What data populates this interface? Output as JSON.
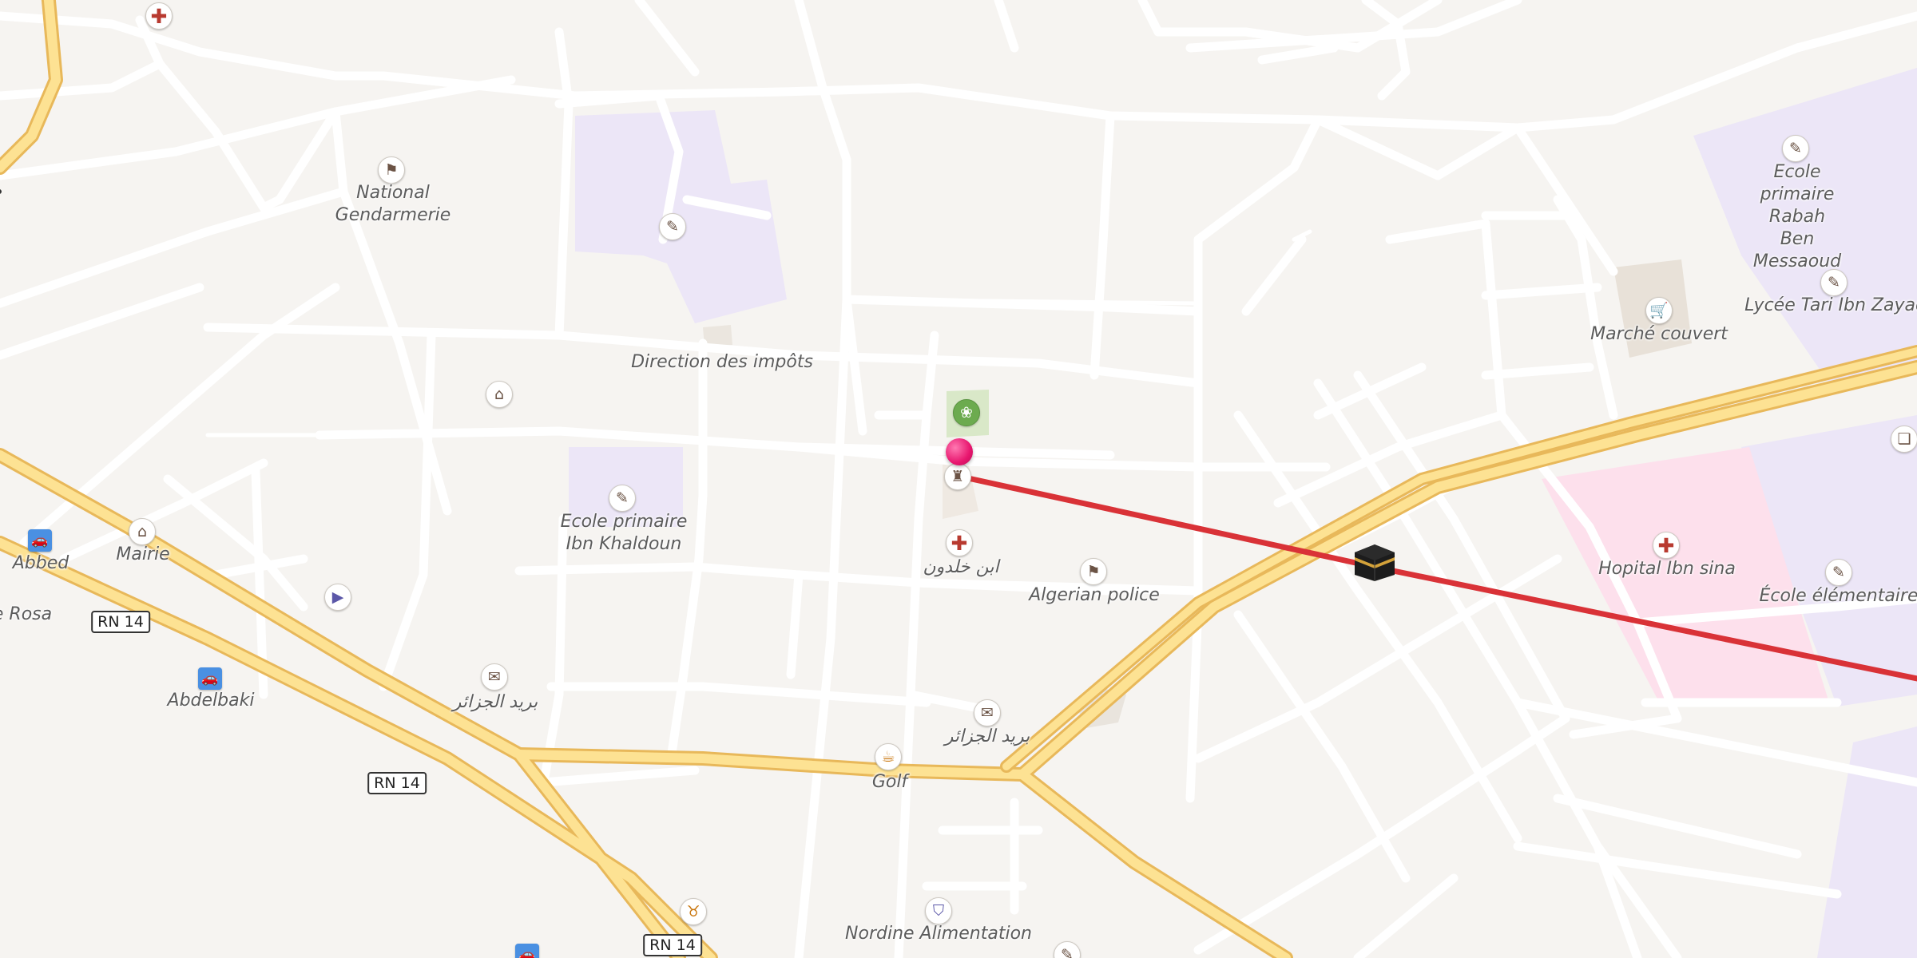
{
  "map": {
    "labels": {
      "national_gendarmerie": "National\nGendarmerie",
      "direction_impots": "Direction des impôts",
      "ecole_ibn_khaldoun": "Ecole primaire\nIbn Khaldoun",
      "ibn_khaldoun_ar": "ابن خلدون",
      "algerian_police": "Algerian police",
      "mairie": "Mairie",
      "abbed": "Abbed",
      "rosa": "e Rosa",
      "abdelbaki": "Abdelbaki",
      "barid_1": "بريد الجزائر",
      "barid_2": "بريد الجزائر",
      "golf": "Golf",
      "nordine": "Nordine Alimentation",
      "ecole_rabah": "Ecole primaire Rabah\nBen Messaoud",
      "lycee_tari": "Lycée Tari Ibn Zayad",
      "marche_couvert": "Marché couvert",
      "hopital": "Hopital Ibn sina",
      "ecole_elementaire": "École élémentaire"
    },
    "road_shields": [
      "RN 14",
      "RN 14",
      "RN 14"
    ],
    "icons": {
      "hospital": "hospital-icon",
      "police": "police-icon",
      "school": "school-icon",
      "townhall": "townhall-icon",
      "post": "post-office-icon",
      "cafe": "cafe-icon",
      "shop": "shopping-icon",
      "car": "car-rental-icon",
      "cinema": "cinema-icon",
      "garden": "garden-icon",
      "mosque": "mosque-icon",
      "butcher": "butcher-icon",
      "book": "library-icon",
      "pin": "location-pin-icon",
      "kaaba": "kaaba-icon"
    },
    "colors": {
      "background": "#f6f4f1",
      "road_minor": "#ffffff",
      "road_major_fill": "#fde293",
      "road_major_casing": "#e8b85a",
      "school_area": "#ece6f7",
      "hospital_area": "#fde0ec",
      "route_line": "#d93237",
      "pin": "#e8166e"
    }
  }
}
